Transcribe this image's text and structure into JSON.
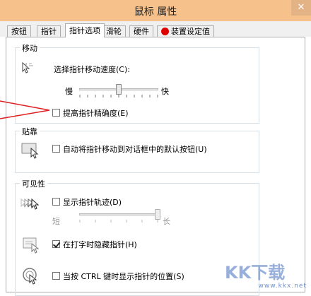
{
  "window": {
    "title": "鼠标 属性",
    "close_label": "✕"
  },
  "tabs": [
    {
      "label": "按钮"
    },
    {
      "label": "指针"
    },
    {
      "label": "指针选项"
    },
    {
      "label": "滑轮"
    },
    {
      "label": "硬件"
    },
    {
      "label": "装置设定值"
    }
  ],
  "motion": {
    "group_label": "移动",
    "speed_label": "选择指针移动速度(C):",
    "slow_label": "慢",
    "fast_label": "快",
    "speed_level": 0.5,
    "precision_label": "提高指针精确度(E)",
    "precision_checked": false
  },
  "snap": {
    "group_label": "贴靠",
    "snap_label": "自动将指针移动到对话框中的默认按钮(U)",
    "snap_checked": false
  },
  "visibility": {
    "group_label": "可见性",
    "trails_label": "显示指针轨迹(D)",
    "trails_checked": false,
    "short_label": "短",
    "long_label": "长",
    "trails_level": 1.0,
    "hide_label": "在打字时隐藏指针(H)",
    "hide_checked": true,
    "ctrl_label": "当按 CTRL 键时显示指针的位置(S)",
    "ctrl_checked": false
  },
  "watermark": {
    "text": "KK下载",
    "url": "www.kkx.net"
  },
  "colors": {
    "titlebar": "#f6c18b",
    "annotation_arrow": "#e02020",
    "watermark": "#6f8fc9"
  },
  "icons": [
    "motion-cursor-icon",
    "snap-button-icon",
    "trails-cursor-icon",
    "hide-typing-icon",
    "ctrl-locate-icon",
    "device-settings-icon"
  ]
}
